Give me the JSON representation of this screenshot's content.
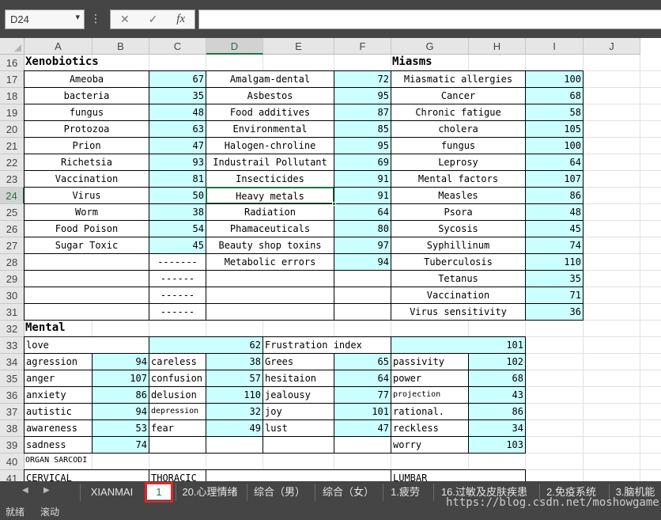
{
  "formula_bar": {
    "name_box": "D24",
    "cancel_icon": "✕",
    "enter_icon": "✓",
    "fx_label": "fx"
  },
  "columns": [
    "A",
    "B",
    "C",
    "D",
    "E",
    "F",
    "G",
    "H",
    "I",
    "J"
  ],
  "selected_column": "D",
  "rows": [
    "16",
    "17",
    "18",
    "19",
    "20",
    "21",
    "22",
    "23",
    "24",
    "25",
    "26",
    "27",
    "28",
    "29",
    "30",
    "31",
    "32",
    "33",
    "34",
    "35",
    "36",
    "37",
    "38",
    "39",
    "40",
    "41"
  ],
  "selected_row": "24",
  "section_titles": {
    "xenobiotics": "Xenobiotics",
    "miasms": "Miasms",
    "mental": "Mental",
    "organ": "ORGAN SARCODI"
  },
  "xeno_list1": [
    {
      "name": "Ameoba",
      "value": "67"
    },
    {
      "name": "bacteria",
      "value": "35"
    },
    {
      "name": "fungus",
      "value": "48"
    },
    {
      "name": "Protozoa",
      "value": "63"
    },
    {
      "name": "Prion",
      "value": "47"
    },
    {
      "name": "Richetsia",
      "value": "93"
    },
    {
      "name": "Vaccination",
      "value": "81"
    },
    {
      "name": "Virus",
      "value": "50"
    },
    {
      "name": "Worm",
      "value": "38"
    },
    {
      "name": "Food Poison",
      "value": "54"
    },
    {
      "name": "Sugar Toxic",
      "value": "45"
    },
    {
      "name": "",
      "value": "-------"
    },
    {
      "name": "",
      "value": "------"
    },
    {
      "name": "",
      "value": "------"
    },
    {
      "name": "",
      "value": "------"
    }
  ],
  "xeno_list2": [
    {
      "name": "Amalgam-dental",
      "value": "72"
    },
    {
      "name": "Asbestos",
      "value": "95"
    },
    {
      "name": "Food additives",
      "value": "87"
    },
    {
      "name": "Environmental",
      "value": "85"
    },
    {
      "name": "Halogen-chroline",
      "value": "95"
    },
    {
      "name": "Industrail Pollutant",
      "value": "69"
    },
    {
      "name": "Insecticides",
      "value": "91"
    },
    {
      "name": "Heavy metals",
      "value": "91"
    },
    {
      "name": "Radiation",
      "value": "64"
    },
    {
      "name": "Phamaceuticals",
      "value": "80"
    },
    {
      "name": "Beauty shop toxins",
      "value": "97"
    },
    {
      "name": "Metabolic errors",
      "value": "94"
    },
    {
      "name": "",
      "value": ""
    },
    {
      "name": "",
      "value": ""
    },
    {
      "name": "",
      "value": ""
    }
  ],
  "miasms_list": [
    {
      "name": "Miasmatic allergies",
      "value": "100"
    },
    {
      "name": "Cancer",
      "value": "68"
    },
    {
      "name": "Chronic fatigue",
      "value": "58"
    },
    {
      "name": "cholera",
      "value": "105"
    },
    {
      "name": "fungus",
      "value": "100"
    },
    {
      "name": "Leprosy",
      "value": "64"
    },
    {
      "name": "Mental factors",
      "value": "107"
    },
    {
      "name": "Measles",
      "value": "86"
    },
    {
      "name": "Psora",
      "value": "48"
    },
    {
      "name": "Sycosis",
      "value": "45"
    },
    {
      "name": "Syphillinum",
      "value": "74"
    },
    {
      "name": "Tuberculosis",
      "value": "110"
    },
    {
      "name": "Tetanus",
      "value": "35"
    },
    {
      "name": "Vaccination",
      "value": "71"
    },
    {
      "name": "Virus sensitivity",
      "value": "36"
    }
  ],
  "mental_top": [
    {
      "name": "love",
      "value": "62"
    },
    {
      "name": "Frustration index",
      "value": "101"
    }
  ],
  "mental_col1": [
    {
      "name": "agression",
      "value": "94"
    },
    {
      "name": "anger",
      "value": "107"
    },
    {
      "name": "anxiety",
      "value": "86"
    },
    {
      "name": "autistic",
      "value": "94"
    },
    {
      "name": "awareness",
      "value": "53"
    },
    {
      "name": "sadness",
      "value": "74"
    }
  ],
  "mental_col2": [
    {
      "name": "careless",
      "value": "38"
    },
    {
      "name": "confusion",
      "value": "57"
    },
    {
      "name": "delusion",
      "value": "110"
    },
    {
      "name": "depression",
      "value": "32"
    },
    {
      "name": "fear",
      "value": "49"
    },
    {
      "name": "",
      "value": ""
    }
  ],
  "mental_col3": [
    {
      "name": "Grees",
      "value": "65"
    },
    {
      "name": "hesitaion",
      "value": "64"
    },
    {
      "name": "jealousy",
      "value": "77"
    },
    {
      "name": "joy",
      "value": "101"
    },
    {
      "name": "lust",
      "value": "47"
    },
    {
      "name": "",
      "value": ""
    }
  ],
  "mental_col4": [
    {
      "name": "passivity",
      "value": "102"
    },
    {
      "name": "power",
      "value": "68"
    },
    {
      "name": "projection",
      "value": "43"
    },
    {
      "name": "rational.",
      "value": "86"
    },
    {
      "name": "reckless",
      "value": "34"
    },
    {
      "name": "worry",
      "value": "103"
    }
  ],
  "row41": {
    "a": "CERVICAL",
    "c": "THORACIC",
    "g": "LUMBAR"
  },
  "sheet_tabs": [
    "XIANMAI",
    "1",
    "20.心理情绪",
    "综合（男）",
    "综合（女）",
    "1.疲劳",
    "16.过敏及皮肤疾患",
    "2.免疫系统",
    "3.脑机能"
  ],
  "active_tab": "1",
  "status": {
    "ready": "就绪",
    "scroll": "滚动"
  },
  "watermark": "https://blog.csdn.net/moshowgame",
  "colors": {
    "cyan_fill": "#ccffff",
    "excel_green": "#217346",
    "chrome_dark": "#454545",
    "highlight_red": "#e0252a"
  }
}
